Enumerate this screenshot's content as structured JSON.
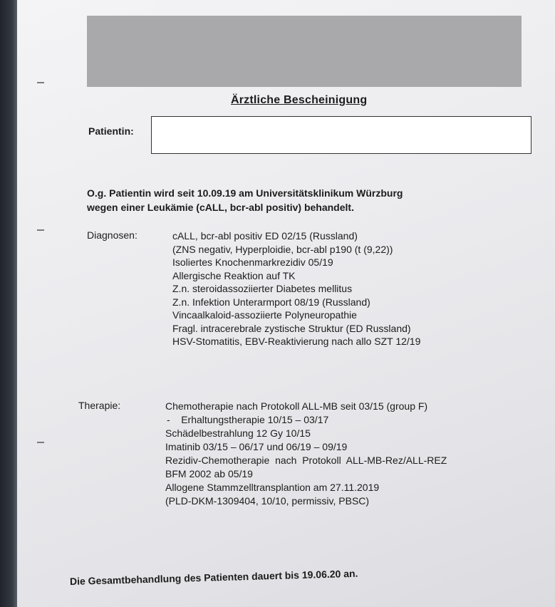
{
  "document": {
    "title": "Ärztliche Bescheinigung",
    "patient_label": "Patientin:",
    "patient_value": "",
    "intro_lines": [
      "O.g. Patientin wird seit 10.09.19 am Universitätsklinikum Würzburg",
      "wegen einer Leukämie (cALL, bcr-abl positiv) behandelt."
    ],
    "diagnosen_label": "Diagnosen:",
    "diagnosen": [
      "cALL, bcr-abl positiv ED 02/15 (Russland)",
      "(ZNS negativ, Hyperploidie, bcr-abl p190 (t (9,22))",
      "Isoliertes Knochenmarkrezidiv 05/19",
      "Allergische Reaktion auf TK",
      "Z.n. steroidassoziierter Diabetes mellitus",
      "Z.n. Infektion Unterarmport 08/19 (Russland)",
      "Vincaalkaloid-assoziierte Polyneuropathie",
      "Fragl. intracerebrale zystische Struktur (ED Russland)",
      "HSV-Stomatitis, EBV-Reaktivierung nach allo SZT 12/19"
    ],
    "therapie_label": "Therapie:",
    "therapie": [
      "Chemotherapie nach Protokoll ALL-MB seit 03/15 (group F)",
      "-    Erhaltungstherapie 10/15 – 03/17",
      "Schädelbestrahlung 12 Gy 10/15",
      "Imatinib 03/15 – 06/17 und 06/19 – 09/19",
      "Rezidiv-Chemotherapie  nach  Protokoll  ALL-MB-Rez/ALL-REZ",
      "BFM 2002 ab 05/19",
      "Allogene Stammzelltransplantion am 27.11.2019",
      "(PLD-DKM-1309404, 10/10, permissiv, PBSC)"
    ],
    "closing": "Die Gesamtbehandlung des Patienten dauert bis 19.06.20 an."
  }
}
